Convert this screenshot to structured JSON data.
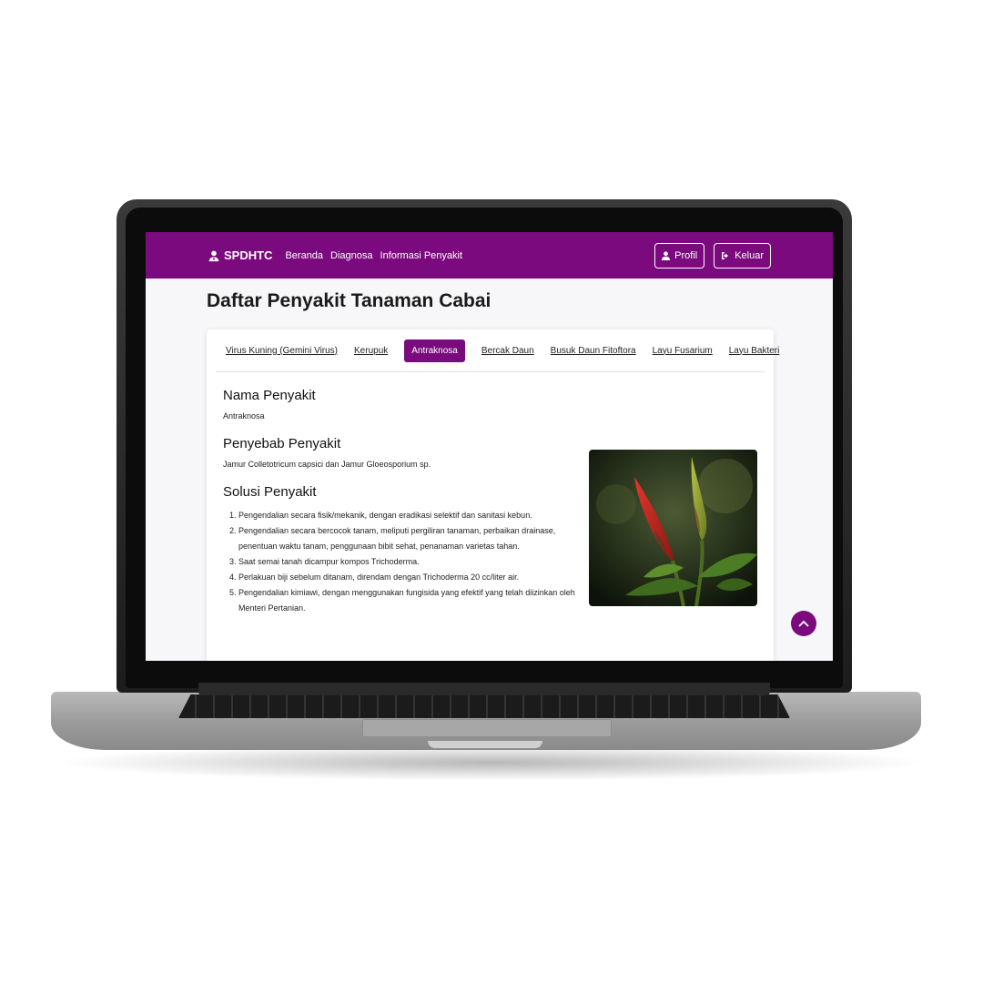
{
  "navbar": {
    "brand": "SPDHTC",
    "links": [
      "Beranda",
      "Diagnosa",
      "Informasi Penyakit"
    ],
    "profile_label": "Profil",
    "logout_label": "Keluar"
  },
  "page": {
    "title": "Daftar Penyakit Tanaman Cabai"
  },
  "tabs": [
    {
      "label": "Virus Kuning (Gemini Virus)",
      "active": false
    },
    {
      "label": "Kerupuk",
      "active": false
    },
    {
      "label": "Antraknosa",
      "active": true
    },
    {
      "label": "Bercak Daun",
      "active": false
    },
    {
      "label": "Busuk Daun Fitoftora",
      "active": false
    },
    {
      "label": "Layu Fusarium",
      "active": false
    },
    {
      "label": "Layu Bakteri",
      "active": false
    }
  ],
  "disease": {
    "name_heading": "Nama Penyakit",
    "name": "Antraknosa",
    "cause_heading": "Penyebab Penyakit",
    "cause": "Jamur Colletotricum capsici dan Jamur Gloeosporium sp.",
    "solution_heading": "Solusi Penyakit",
    "solutions": [
      "Pengendalian secara fisik/mekanik, dengan eradikasi selektif dan sanitasi kebun.",
      "Pengendalian secara bercocok tanam, meliputi pergiliran tanaman, perbaikan drainase, penentuan waktu tanam, penggunaan bibit sehat, penanaman varietas tahan.",
      "Saat semai tanah dicampur kompos Trichoderma.",
      "Perlakuan biji sebelum ditanam, direndam dengan Trichoderma 20 cc/liter air.",
      "Pengendalian kimiawi, dengan menggunakan fungisida yang efektif yang telah diizinkan oleh Menteri Pertanian."
    ]
  },
  "colors": {
    "primary": "#7b0a7e"
  },
  "icons": {
    "brand": "user-doctor-icon",
    "profile": "user-icon",
    "logout": "sign-out-icon",
    "scroll_top": "chevron-up-icon"
  }
}
